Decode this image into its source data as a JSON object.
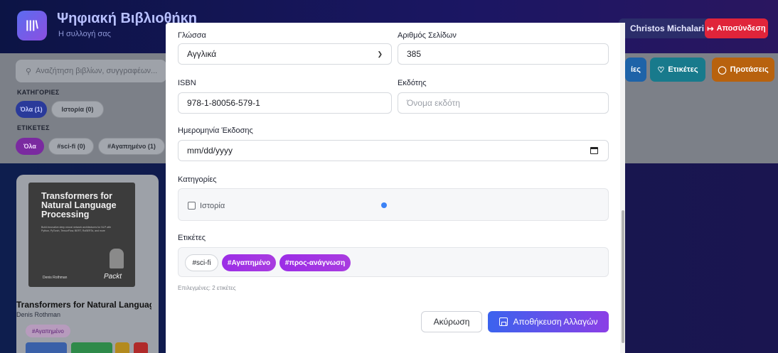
{
  "app": {
    "title": "Ψηφιακή Βιβλιοθήκη",
    "subtitle": "Η συλλογή σας",
    "logo_glyph": "|||\\",
    "user_name": "Christos Michalari",
    "logout_label": "Αποσύνδεση",
    "logout_icon": "↦"
  },
  "search": {
    "placeholder": "Αναζήτηση βιβλίων, συγγραφέων..."
  },
  "filters": {
    "categories_heading": "ΚΑΤΗΓΟΡΙΕΣ",
    "categories": [
      {
        "label": "Όλα (1)",
        "active": true
      },
      {
        "label": "Ιστορία (0)",
        "active": false
      }
    ],
    "tags_heading": "ΕΤΙΚΕΤΕΣ",
    "tags": [
      {
        "label": "Όλα",
        "active": true
      },
      {
        "label": "#sci-fi (0)",
        "active": false
      },
      {
        "label": "#Αγαπημένο (1)",
        "active": false
      }
    ]
  },
  "toolbar": {
    "categories_partial_label": "ίες",
    "tags_button_label": "Ετικέτες",
    "suggestions_button_label": "Προτάσεις",
    "colors": {
      "blue": "#1e63a8",
      "teal": "#187a8c",
      "orange": "#b8620e"
    }
  },
  "book_card": {
    "cover_title": "Transformers for Natural Language Processing",
    "cover_blurb": "Build innovative deep neural network architectures for NLP with Python, PyTorch, TensorFlow, BERT, RoBERTa, and more",
    "cover_author": "Denis Rothman",
    "cover_publisher": "Packt",
    "title": "Transformers for Natural Languag...",
    "author": "Denis Rothman",
    "tag": "#Αγαπημένο"
  },
  "modal": {
    "language": {
      "label": "Γλώσσα",
      "value": "Αγγλικά"
    },
    "pages": {
      "label": "Αριθμός Σελίδων",
      "value": "385"
    },
    "isbn": {
      "label": "ISBN",
      "value": "978-1-80056-579-1"
    },
    "publisher": {
      "label": "Εκδότης",
      "placeholder": "Όνομα εκδότη"
    },
    "publish_date": {
      "label": "Ημερομηνία Έκδοσης",
      "value": "mm/dd/yyyy"
    },
    "categories": {
      "label": "Κατηγορίες",
      "options": [
        {
          "label": "Ιστορία",
          "checked": false
        }
      ]
    },
    "tags": {
      "label": "Ετικέτες",
      "options": [
        {
          "label": "#sci-fi",
          "selected": false
        },
        {
          "label": "#Αγαπημένο",
          "selected": true
        },
        {
          "label": "#προς-ανάγνωση",
          "selected": true
        }
      ],
      "selected_summary": "Επιλεγμένες: 2 ετικέτες"
    },
    "cancel_label": "Ακύρωση",
    "save_label": "Αποθήκευση Αλλαγών"
  }
}
